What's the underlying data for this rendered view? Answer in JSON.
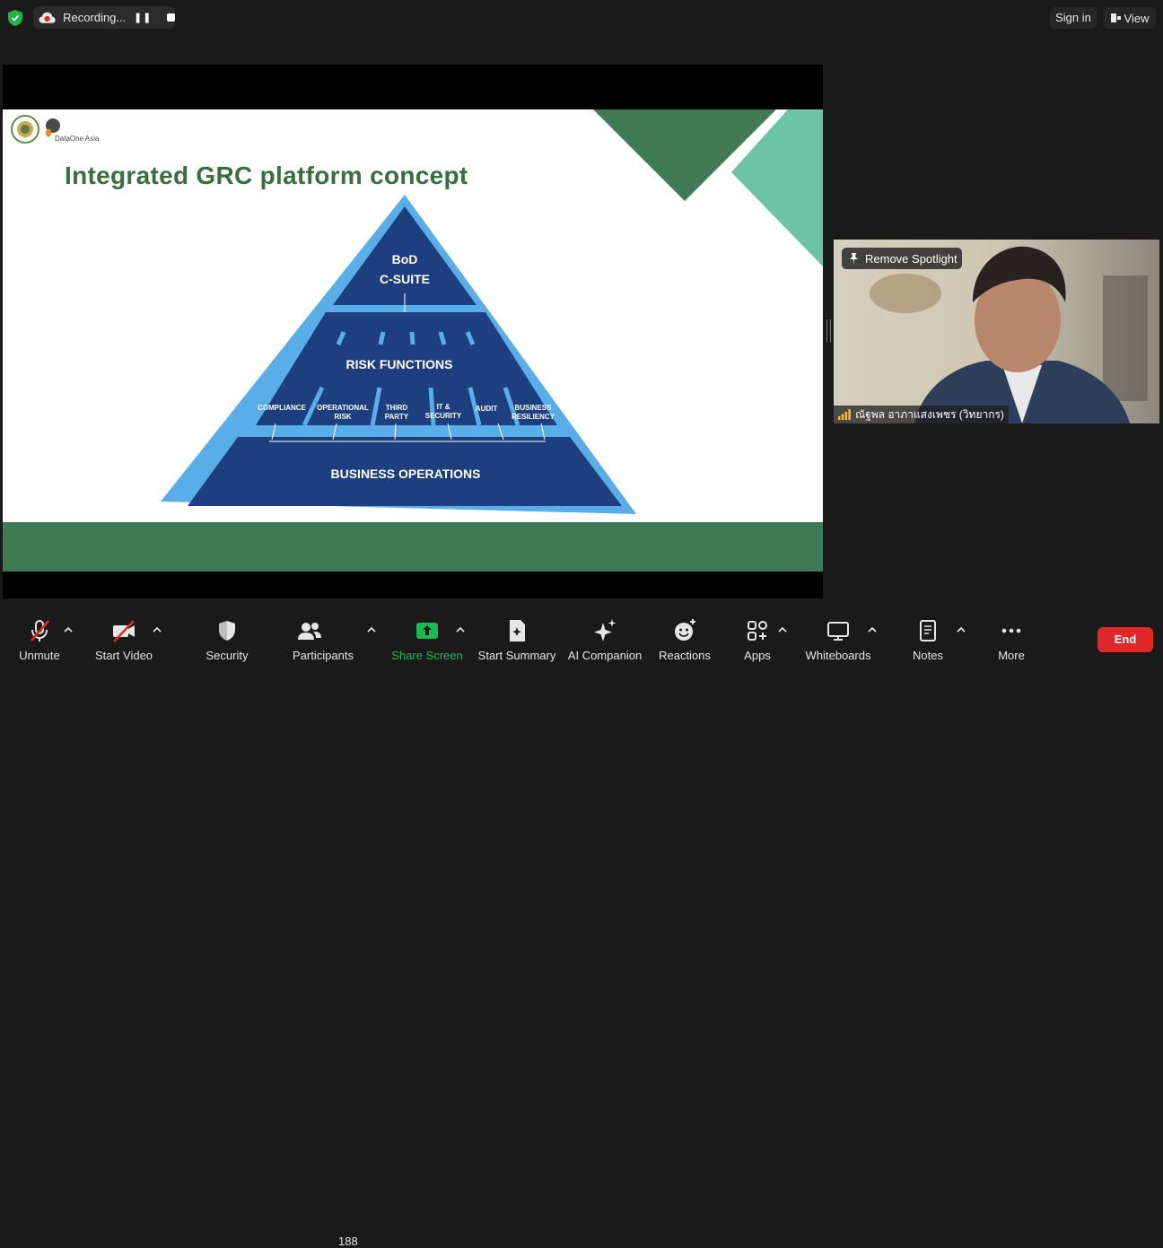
{
  "top": {
    "recording_label": "Recording...",
    "sign_in_label": "Sign in",
    "view_label": "View"
  },
  "slide": {
    "title": "Integrated GRC platform concept",
    "logo_text": "DataOne Asia",
    "pyramid": {
      "top": [
        "BoD",
        "C-SUITE"
      ],
      "middle": "RISK FUNCTIONS",
      "functions": [
        "COMPLIANCE",
        "OPERATIONAL",
        "RISK",
        "THIRD",
        "PARTY",
        "IT &",
        "SECURITY",
        "AUDIT",
        "BUSINESS",
        "RESILIENCY"
      ],
      "bottom": "BUSINESS OPERATIONS"
    },
    "colors": {
      "accent_green": "#3a6e3e",
      "pyramid_navy": "#1e3f7f",
      "pyramid_light_blue": "#5aaee8",
      "teal": "#6cc3a6"
    }
  },
  "video": {
    "spotlight_label": "Remove Spotlight",
    "participant_name": "ณัฐพล อาภาแสงเพชร (วิทยากร)"
  },
  "toolbar": {
    "unmute": "Unmute",
    "start_video": "Start Video",
    "security": "Security",
    "participants": "Participants",
    "participants_count": "188",
    "share_screen": "Share Screen",
    "start_summary": "Start Summary",
    "ai_companion": "AI Companion",
    "reactions": "Reactions",
    "apps": "Apps",
    "whiteboards": "Whiteboards",
    "notes": "Notes",
    "more": "More",
    "end": "End"
  }
}
